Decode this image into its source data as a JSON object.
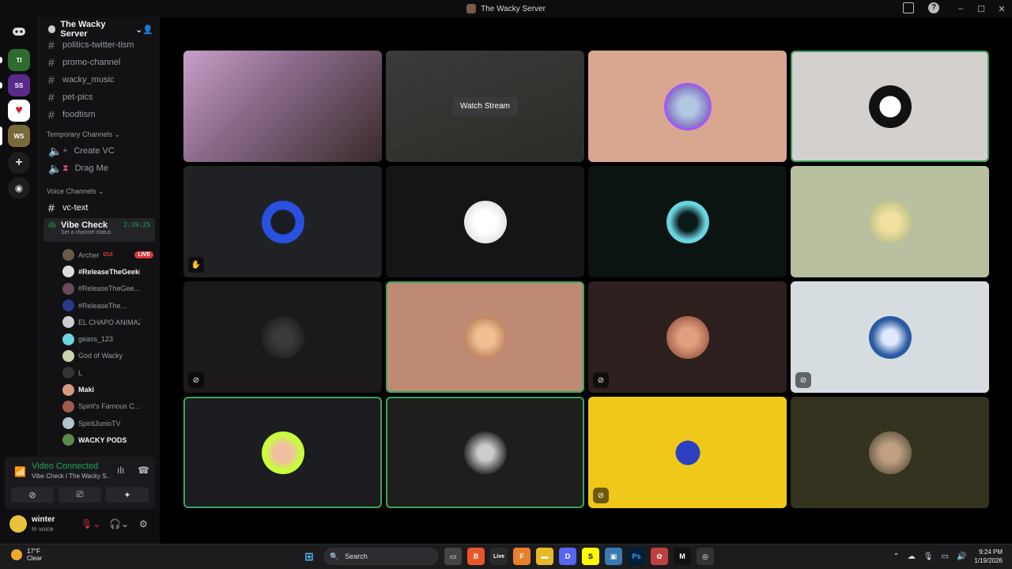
{
  "window": {
    "title": "The Wacky Server"
  },
  "rail": {
    "servers": [
      "Turd Island",
      "Spindle Studio",
      "Hearts",
      "Wacky Server"
    ]
  },
  "sidebar": {
    "server_name": "The Wacky Server",
    "text_channels": [
      "politics-twitter-tism",
      "promo-channel",
      "wacky_music",
      "pet-pics",
      "foodtism"
    ],
    "temp_category": "Temporary Channels",
    "temp_channels": [
      "Create VC",
      "Drag Me"
    ],
    "voice_category": "Voice Channels",
    "vc_text": "vc-text",
    "voice_channel": {
      "name": "Vibe Check",
      "time": "2:39:25",
      "status": "Set a channel status"
    },
    "users": [
      {
        "name": "Archer",
        "extra": "DUI",
        "live": "LIVE",
        "bold": false,
        "color": "#6b5a4a"
      },
      {
        "name": "#ReleaseTheGeekFiles",
        "bold": true,
        "color": "#ddd"
      },
      {
        "name": "#ReleaseTheGee...",
        "bold": false,
        "color": "#6a4a5a"
      },
      {
        "name": "#ReleaseThe...",
        "bold": false,
        "color": "#2a3a8a"
      },
      {
        "name": "EL CHAPO ANIMAZE...",
        "bold": false,
        "color": "#cfcfcf"
      },
      {
        "name": "geass_123",
        "bold": false,
        "color": "#6ad4e0"
      },
      {
        "name": "God of Wacky",
        "bold": false,
        "color": "#c9d4b0"
      },
      {
        "name": "L",
        "bold": false,
        "color": "#333"
      },
      {
        "name": "Maki",
        "bold": true,
        "color": "#d39a80"
      },
      {
        "name": "Spirit's Famous C...",
        "bold": false,
        "color": "#a05a4a"
      },
      {
        "name": "SpiritJunioTV",
        "bold": false,
        "color": "#b0c4d0"
      },
      {
        "name": "WACKY PODS",
        "bold": true,
        "color": "#5a8a4a"
      }
    ]
  },
  "voice_panel": {
    "status": "Video Connected",
    "sub": "Vibe Check / The Wacky S..."
  },
  "user_bar": {
    "name": "winter",
    "status": "In voice"
  },
  "stage": {
    "watch_label": "Watch Stream"
  },
  "taskbar": {
    "weather_temp": "17°F",
    "weather_desc": "Clear",
    "search_placeholder": "Search",
    "time": "9:24 PM",
    "date": "1/19/2026",
    "badge": "4"
  }
}
